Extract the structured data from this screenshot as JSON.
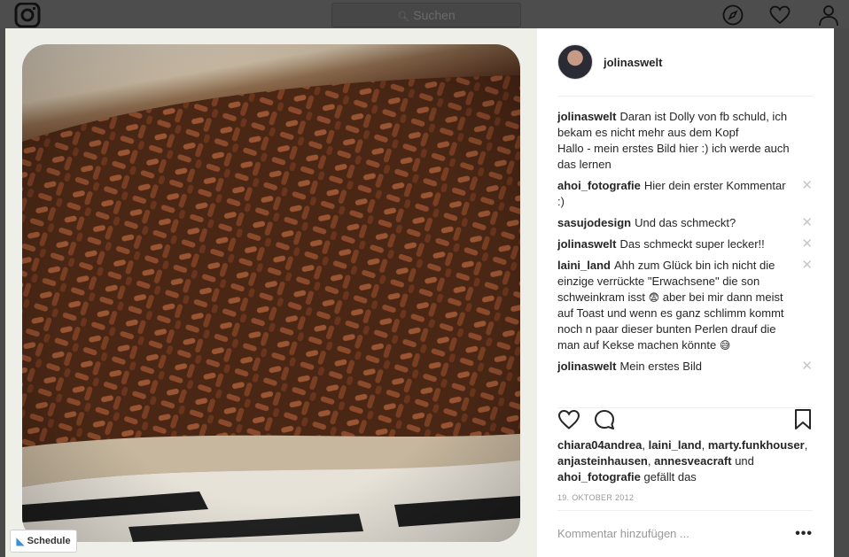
{
  "nav": {
    "search_placeholder": "Suchen"
  },
  "post": {
    "username": "jolinaswelt",
    "schedule_label": "Schedule",
    "caption_user": "jolinaswelt",
    "caption_text": "Daran ist Dolly von fb schuld, ich bekam es nicht mehr aus dem Kopf",
    "caption_text2": "Hallo - mein erstes Bild hier :) ich werde auch das lernen",
    "comments": [
      {
        "user": "ahoi_fotografie",
        "text": "Hier dein erster Kommentar :)"
      },
      {
        "user": "sasujodesign",
        "text": "Und das schmeckt?"
      },
      {
        "user": "jolinaswelt",
        "text": "Das schmeckt super lecker!!"
      },
      {
        "user": "laini_land",
        "text": "Ahh zum Glück bin ich nicht die einzige verrückte \"Erwachsene\" die son schweinkram isst",
        "text2": "aber bei mir dann meist auf Toast und wenn es ganz schlimm kommt noch n paar dieser bunten Perlen drauf die man auf Kekse machen könnte",
        "emoji1": "😨",
        "emoji2": "😅"
      },
      {
        "user": "jolinaswelt",
        "text": "Mein erstes Bild"
      }
    ],
    "likes": {
      "users": [
        "chiara04andrea",
        "laini_land",
        "marty.funkhouser",
        "anjasteinhausen",
        "annesveacraft",
        "ahoi_fotografie"
      ],
      "sep": ", ",
      "and": "und",
      "suffix": "gefällt das"
    },
    "date": "19. OKTOBER 2012",
    "comment_placeholder": "Kommentar hinzufügen ...",
    "more_label": "•••"
  },
  "colors": {
    "accent_blue": "#3897f0",
    "text": "#262626",
    "muted": "#999999",
    "divider": "#efefef"
  },
  "icons": [
    "instagram-logo-icon",
    "search-icon",
    "compass-icon",
    "heart-icon",
    "profile-icon",
    "like-heart-icon",
    "comment-bubble-icon",
    "bookmark-icon",
    "close-icon"
  ]
}
